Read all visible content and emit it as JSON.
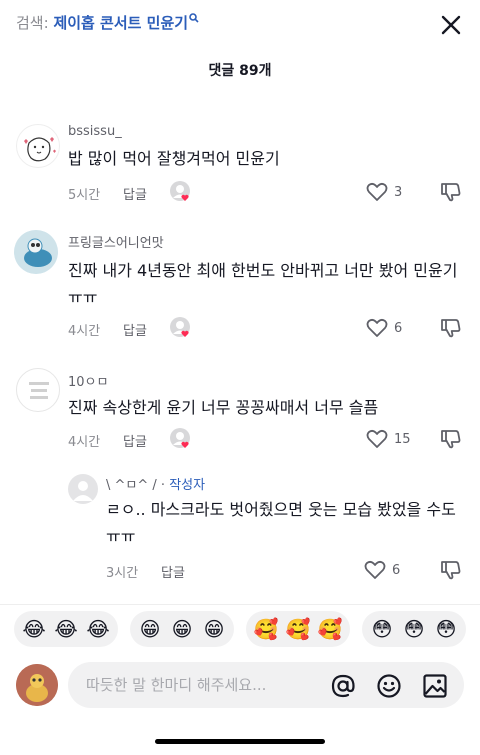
{
  "header": {
    "search_prefix": "검색:",
    "search_query": "제이홉 콘서트 민윤기",
    "comment_count": "댓글 89개"
  },
  "comments": [
    {
      "username": "bssissu_",
      "text": "밥 많이 먹어 잘챙겨먹어 민윤기",
      "time": "5시간",
      "reply_label": "답글",
      "likes": "3"
    },
    {
      "username": "프링글스어니언맛",
      "text": "진짜 내가 4년동안 최애 한번도 안바뀌고 너만 봤어 민윤기 ㅠㅠ",
      "time": "4시간",
      "reply_label": "답글",
      "likes": "6"
    },
    {
      "username": "10ㅇㅁ",
      "text": "진짜 속상한게 윤기 너무 꽁꽁싸매서 너무 슬픔",
      "time": "4시간",
      "reply_label": "답글",
      "likes": "15"
    }
  ],
  "reply": {
    "username": "\\ ^ㅁ^ /",
    "separator": " · ",
    "author_badge": "작성자",
    "text": "ㄹㅇ.. 마스크라도 벗어줬으면 웃는 모습 봤었을 수도ㅠㅠ",
    "time": "3시간",
    "reply_label": "답글",
    "likes": "6"
  },
  "emoji_bar": [
    {
      "icon": "tears-of-joy",
      "glyphs": [
        "😂",
        "😂",
        "😂"
      ]
    },
    {
      "icon": "grinning",
      "glyphs": [
        "😁",
        "😁",
        "😁"
      ]
    },
    {
      "icon": "smiling-hearts",
      "glyphs": [
        "🥰",
        "🥰",
        "🥰"
      ]
    },
    {
      "icon": "flushed",
      "glyphs": [
        "😳",
        "😳",
        "😳"
      ]
    }
  ],
  "input": {
    "placeholder": "따듯한 말 한마디 해주세요..."
  },
  "colors": {
    "accent": "#2b5db9",
    "text": "#161823",
    "muted": "#8a8b91",
    "heart": "#fe2c55"
  }
}
